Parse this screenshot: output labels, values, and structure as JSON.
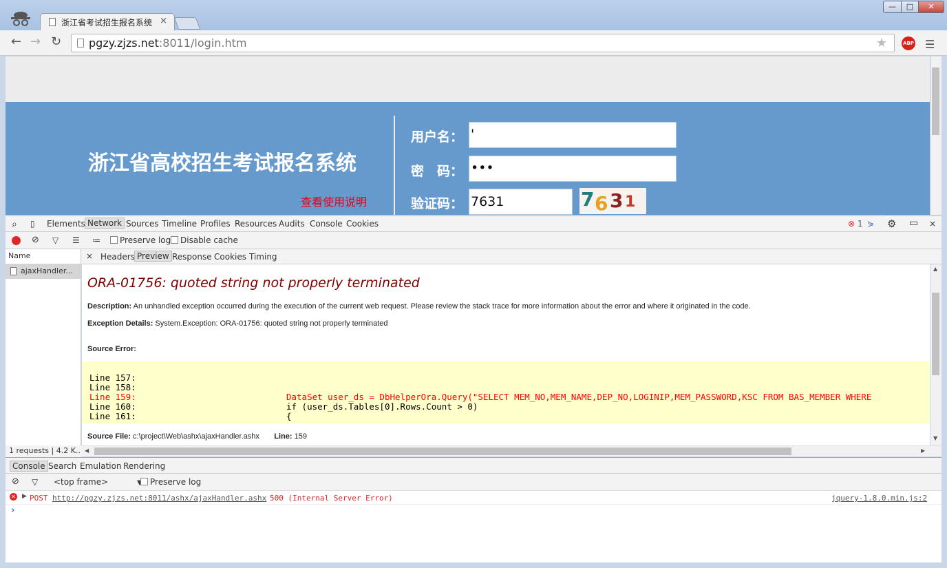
{
  "browser": {
    "tab_title": "浙江省考试招生报名系统",
    "tab_close": "×",
    "window_minimize": "—",
    "window_maximize": "□",
    "window_close": "✕",
    "url_host": "pgzy.zjzs.net",
    "url_rest": ":8011/login.htm",
    "abp_label": "ABP"
  },
  "page": {
    "system_title": "浙江省高校招生考试报名系统",
    "help_link": "查看使用说明",
    "username_label": "用户名：",
    "username_value": "'",
    "password_label": "密　码：",
    "password_value": "•••",
    "captcha_label": "验证码：",
    "captcha_value": "7631",
    "captcha_digits": [
      "7",
      "6",
      "3",
      "1"
    ],
    "captcha_colors": [
      "#1d7f7a",
      "#e8a020",
      "#8b2320",
      "#c0392b"
    ]
  },
  "devtools": {
    "tabs": [
      "Elements",
      "Network",
      "Sources",
      "Timeline",
      "Profiles",
      "Resources",
      "Audits",
      "Console",
      "Cookies"
    ],
    "active_tab": "Network",
    "error_count": "1",
    "preserve_log": "Preserve log",
    "disable_cache": "Disable cache",
    "name_header": "Name",
    "request_name": "ajaxHandler...",
    "response_tabs": [
      "Headers",
      "Preview",
      "Response",
      "Cookies",
      "Timing"
    ],
    "active_response_tab": "Preview",
    "status": "1 requests | 4.2 K..."
  },
  "preview": {
    "error_title": "ORA-01756: quoted string not properly terminated",
    "description_label": "Description:",
    "description_text": " An unhandled exception occurred during the execution of the current web request. Please review the stack trace for more information about the error and where it originated in the code.",
    "exception_label": "Exception Details:",
    "exception_text": " System.Exception: ORA-01756: quoted string not properly terminated",
    "source_error_label": "Source Error:",
    "code_lines": [
      {
        "text": "Line 157:",
        "error": false
      },
      {
        "text": "Line 158:",
        "error": false
      },
      {
        "text": "Line 159:                             DataSet user_ds = DbHelperOra.Query(\"SELECT MEM_NO,MEM_NAME,DEP_NO,LOGINIP,MEM_PASSWORD,KSC FROM BAS_MEMBER WHERE",
        "error": true
      },
      {
        "text": "Line 160:                             if (user_ds.Tables[0].Rows.Count > 0)",
        "error": false
      },
      {
        "text": "Line 161:                             {",
        "error": false
      }
    ],
    "source_file_label": "Source File:",
    "source_file_value": " c:\\project\\Web\\ashx\\ajaxHandler.ashx",
    "line_label": "Line:",
    "line_value": " 159"
  },
  "drawer": {
    "tabs": [
      "Console",
      "Search",
      "Emulation",
      "Rendering"
    ],
    "active_tab": "Console",
    "frame_select": "<top frame>",
    "preserve_log": "Preserve log",
    "log_method": "POST",
    "log_url": "http://pgzy.zjzs.net:8011/ashx/ajaxHandler.ashx",
    "log_status": "500 (Internal Server Error)",
    "log_source": "jquery-1.8.0.min.js:2",
    "prompt": "›"
  }
}
